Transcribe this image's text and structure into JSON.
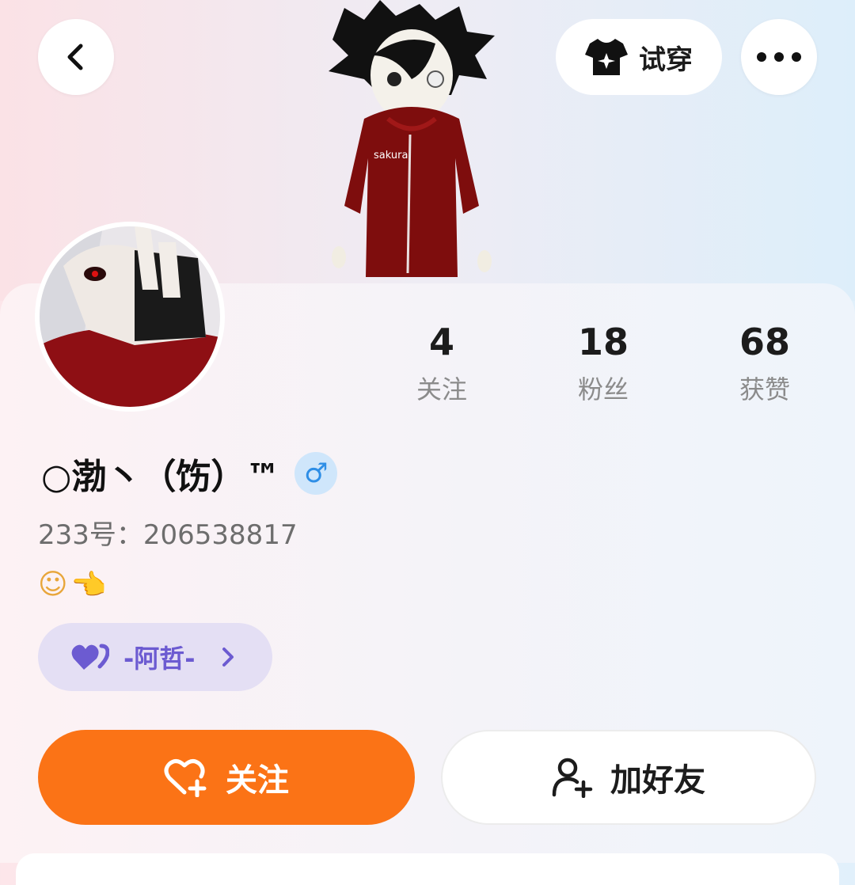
{
  "header": {
    "try_on_label": "试穿"
  },
  "stats": [
    {
      "value": "4",
      "label": "关注"
    },
    {
      "value": "18",
      "label": "粉丝"
    },
    {
      "value": "68",
      "label": "获赞"
    }
  ],
  "profile": {
    "nickname": "○渤丶（饬）™",
    "gender_symbol": "♂",
    "uid": "233号：206538817",
    "bio_emojis": [
      "☺",
      "👈"
    ]
  },
  "cp_chip": {
    "label": "-阿哲-"
  },
  "actions": {
    "follow_label": "关注",
    "add_friend_label": "加好友"
  },
  "colors": {
    "follow_button": "#fb7316",
    "chip_bg": "#e4dff4",
    "chip_text": "#6c5bd1",
    "gender_badge": "#2e8ee6"
  }
}
